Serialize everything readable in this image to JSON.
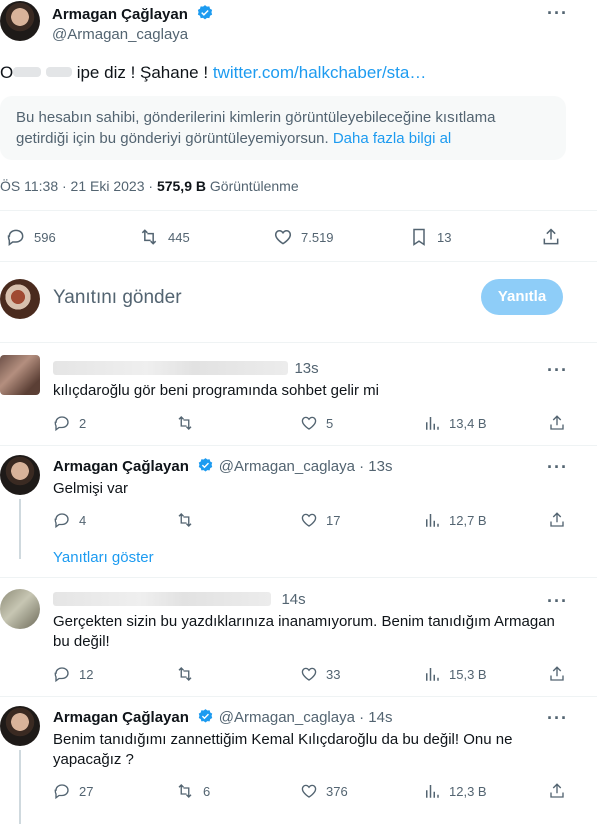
{
  "main_tweet": {
    "name": "Armagan Çağlayan",
    "handle": "@Armagan_caglaya",
    "text_prefix": "O",
    "text_main": "ipe diz ! Şahane !",
    "link": "twitter.com/halkchaber/sta…",
    "notice_text": "Bu hesabın sahibi, gönderilerini kimlerin görüntüleyebileceğine kısıtlama getirdiği için bu gönderiyi görüntüleyemiyorsun.",
    "notice_link": "Daha fazla bilgi al",
    "time": "ÖS 11:38 · 21 Eki 2023 ·",
    "views": "575,9 B",
    "views_label": "Görüntülenme",
    "replies": "596",
    "retweets": "445",
    "likes": "7.519",
    "bookmarks": "13"
  },
  "composer": {
    "placeholder": "Yanıtını gönder",
    "button_label": "Yanıtla"
  },
  "replies": [
    {
      "time": "13s",
      "text": "kılıçdaroğlu gör beni programında sohbet gelir mi",
      "replies": "2",
      "retweets": "",
      "likes": "5",
      "views": "13,4 B"
    },
    {
      "name": "Armagan Çağlayan",
      "handle": "@Armagan_caglaya · 13s",
      "text": "Gelmişi var",
      "replies": "4",
      "retweets": "",
      "likes": "17",
      "views": "12,7 B",
      "show_replies": "Yanıtları göster"
    },
    {
      "time": "14s",
      "text": "Gerçekten sizin bu yazdıklarınıza inanamıyorum. Benim tanıdığım Armagan bu değil!",
      "replies": "12",
      "retweets": "",
      "likes": "33",
      "views": "15,3 B"
    },
    {
      "name": "Armagan Çağlayan",
      "handle": "@Armagan_caglaya · 14s",
      "text": "Benim tanıdığımı zannettiğim Kemal Kılıçdaroğlu da bu değil! Onu ne yapacağız ?",
      "replies": "27",
      "retweets": "6",
      "likes": "376",
      "views": "12,3 B"
    }
  ],
  "colors": {
    "accent": "#1d9bf0",
    "button_disabled": "#8ecdf8",
    "secondary_text": "#536471",
    "divider": "#eff3f4"
  }
}
